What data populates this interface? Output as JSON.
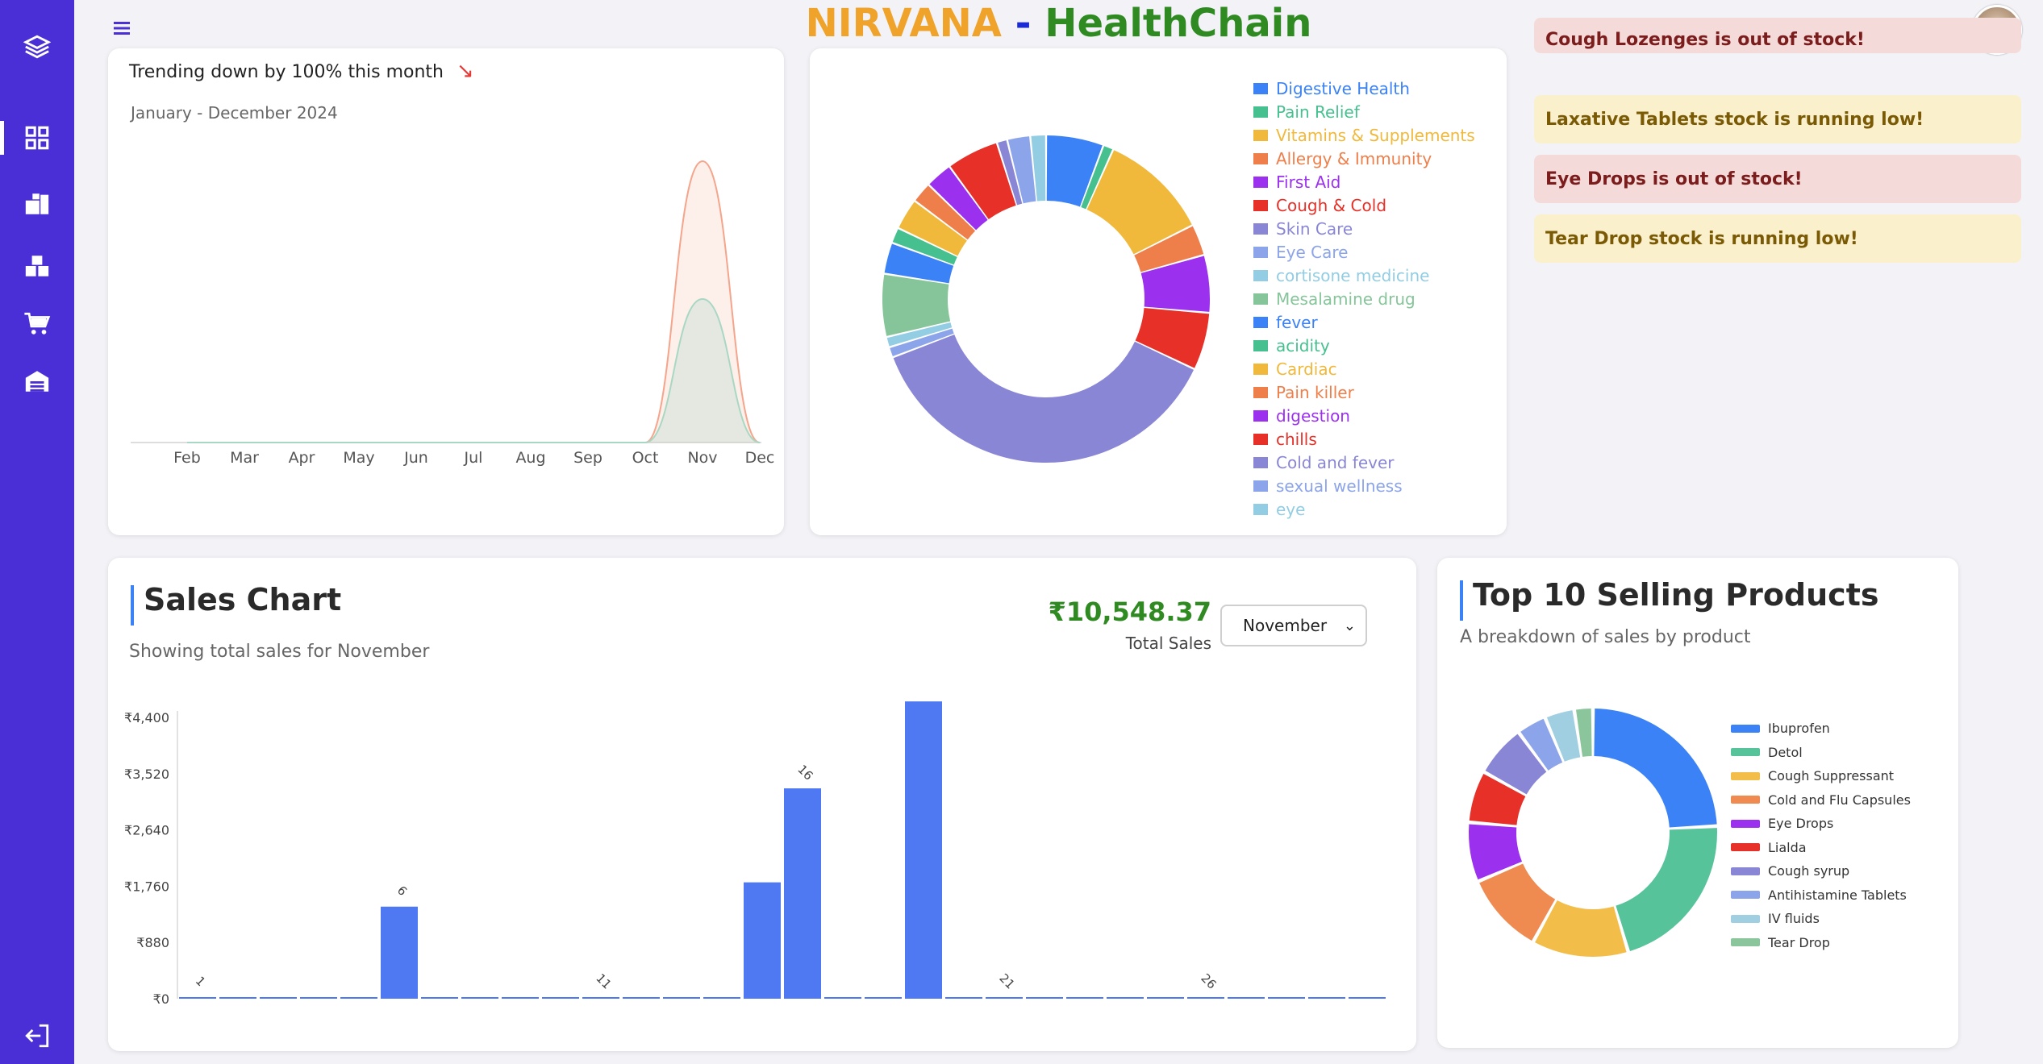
{
  "header": {
    "brand_part1": "NIRVANA",
    "brand_sep": " - ",
    "brand_part2": "HealthChain",
    "colors": {
      "part1": "#f0a32a",
      "sep": "#1a2bd6",
      "part2": "#2f8a22"
    }
  },
  "sidebar": {
    "items": [
      {
        "icon": "layers-icon",
        "active": false
      },
      {
        "icon": "dashboard-grid-icon",
        "active": true
      },
      {
        "icon": "inventory-icon",
        "active": false
      },
      {
        "icon": "boxes-icon",
        "active": false
      },
      {
        "icon": "cart-icon",
        "active": false
      },
      {
        "icon": "warehouse-icon",
        "active": false
      },
      {
        "icon": "logout-icon",
        "active": false
      }
    ]
  },
  "trend_card": {
    "trend_text": "Trending down by 100% this month",
    "trend_icon": "↘",
    "period": "January - December 2024",
    "chart_data": {
      "type": "area",
      "categories": [
        "Feb",
        "Mar",
        "Apr",
        "May",
        "Jun",
        "Jul",
        "Aug",
        "Sep",
        "Oct",
        "Nov",
        "Dec"
      ],
      "series": [
        {
          "color": "#f4a58c",
          "values": [
            0,
            0,
            0,
            0,
            0,
            0,
            0,
            0,
            0,
            100,
            0
          ]
        },
        {
          "color": "#a8d8c4",
          "values": [
            0,
            0,
            0,
            0,
            0,
            0,
            0,
            0,
            0,
            51,
            0
          ]
        }
      ]
    }
  },
  "category_card": {
    "chart_data": {
      "type": "pie",
      "labels": [
        "Digestive Health",
        "Pain Relief",
        "Vitamins & Supplements",
        "Allergy & Immunity",
        "First Aid",
        "Cough & Cold",
        "Skin Care",
        "Eye Care",
        "cortisone medicine",
        "Mesalamine drug",
        "fever",
        "acidity",
        "Cardiac",
        "Pain killer",
        "digestion",
        "chills",
        "Cold and fever",
        "sexual wellness",
        "eye"
      ],
      "values": [
        5.5,
        1,
        10.5,
        3,
        5.5,
        5.5,
        36,
        1,
        1,
        6,
        3,
        1.5,
        3,
        2,
        2.6,
        5,
        1,
        2.2,
        1.5
      ],
      "colors": [
        "#3b82f6",
        "#46c08f",
        "#f0b93b",
        "#ef7f4a",
        "#9b30ef",
        "#e63028",
        "#8a86d6",
        "#8ca4e9",
        "#93cde3",
        "#86c59a",
        "#3b82f6",
        "#46c08f",
        "#f0b93b",
        "#ef7f4a",
        "#9b30ef",
        "#e63028",
        "#8a86d6",
        "#8ca4e9",
        "#93cde3"
      ]
    }
  },
  "alerts": [
    {
      "text": "Cough Lozenges is out of stock!",
      "type": "red"
    },
    {
      "text": "Laxative Tablets stock is running low!",
      "type": "yellow"
    },
    {
      "text": "Eye Drops is out of stock!",
      "type": "red"
    },
    {
      "text": "Tear Drop stock is running low!",
      "type": "yellow"
    }
  ],
  "sales_card": {
    "title": "Sales Chart",
    "subtitle": "Showing total sales for November",
    "total_value": "₹10,548.37",
    "total_label": "Total Sales",
    "month_selected": "November",
    "chart_data": {
      "type": "bar",
      "color": "#4f79f3",
      "y_ticks": [
        "₹0",
        "₹880",
        "₹1,760",
        "₹2,640",
        "₹3,520",
        "₹4,400"
      ],
      "ylim": [
        0,
        4400
      ],
      "x_labels": {
        "1": "1",
        "6": "6",
        "11": "11",
        "16": "16",
        "21": "21",
        "26": "26"
      },
      "days": [
        1,
        2,
        3,
        4,
        5,
        6,
        7,
        8,
        9,
        10,
        11,
        12,
        13,
        14,
        15,
        16,
        17,
        18,
        19,
        20,
        21,
        22,
        23,
        24,
        25,
        26,
        27,
        28,
        29,
        30
      ],
      "values": [
        0,
        0,
        0,
        0,
        0,
        1440,
        0,
        0,
        0,
        0,
        0,
        0,
        0,
        0,
        1820,
        3290,
        0,
        0,
        4650,
        0,
        0,
        0,
        0,
        0,
        0,
        0,
        0,
        0,
        0,
        0
      ]
    }
  },
  "top_products": {
    "title": "Top 10 Selling Products",
    "subtitle": "A breakdown of sales by product",
    "chart_data": {
      "type": "pie",
      "labels": [
        "Ibuprofen",
        "Detol",
        "Cough Suppressant",
        "Cold and Flu Capsules",
        "Eye Drops",
        "Lialda",
        "Cough syrup",
        "Antihistamine Tablets",
        "IV fluids",
        "Tear Drop"
      ],
      "values": [
        25,
        22,
        13,
        11,
        8,
        7,
        7,
        4,
        4,
        2.5
      ],
      "colors": [
        "#3b82f6",
        "#56c39b",
        "#f3bd4a",
        "#ef8a50",
        "#9b30ef",
        "#e63028",
        "#8a86d6",
        "#8ca4e9",
        "#9fcfe0",
        "#8bc59b"
      ]
    }
  }
}
